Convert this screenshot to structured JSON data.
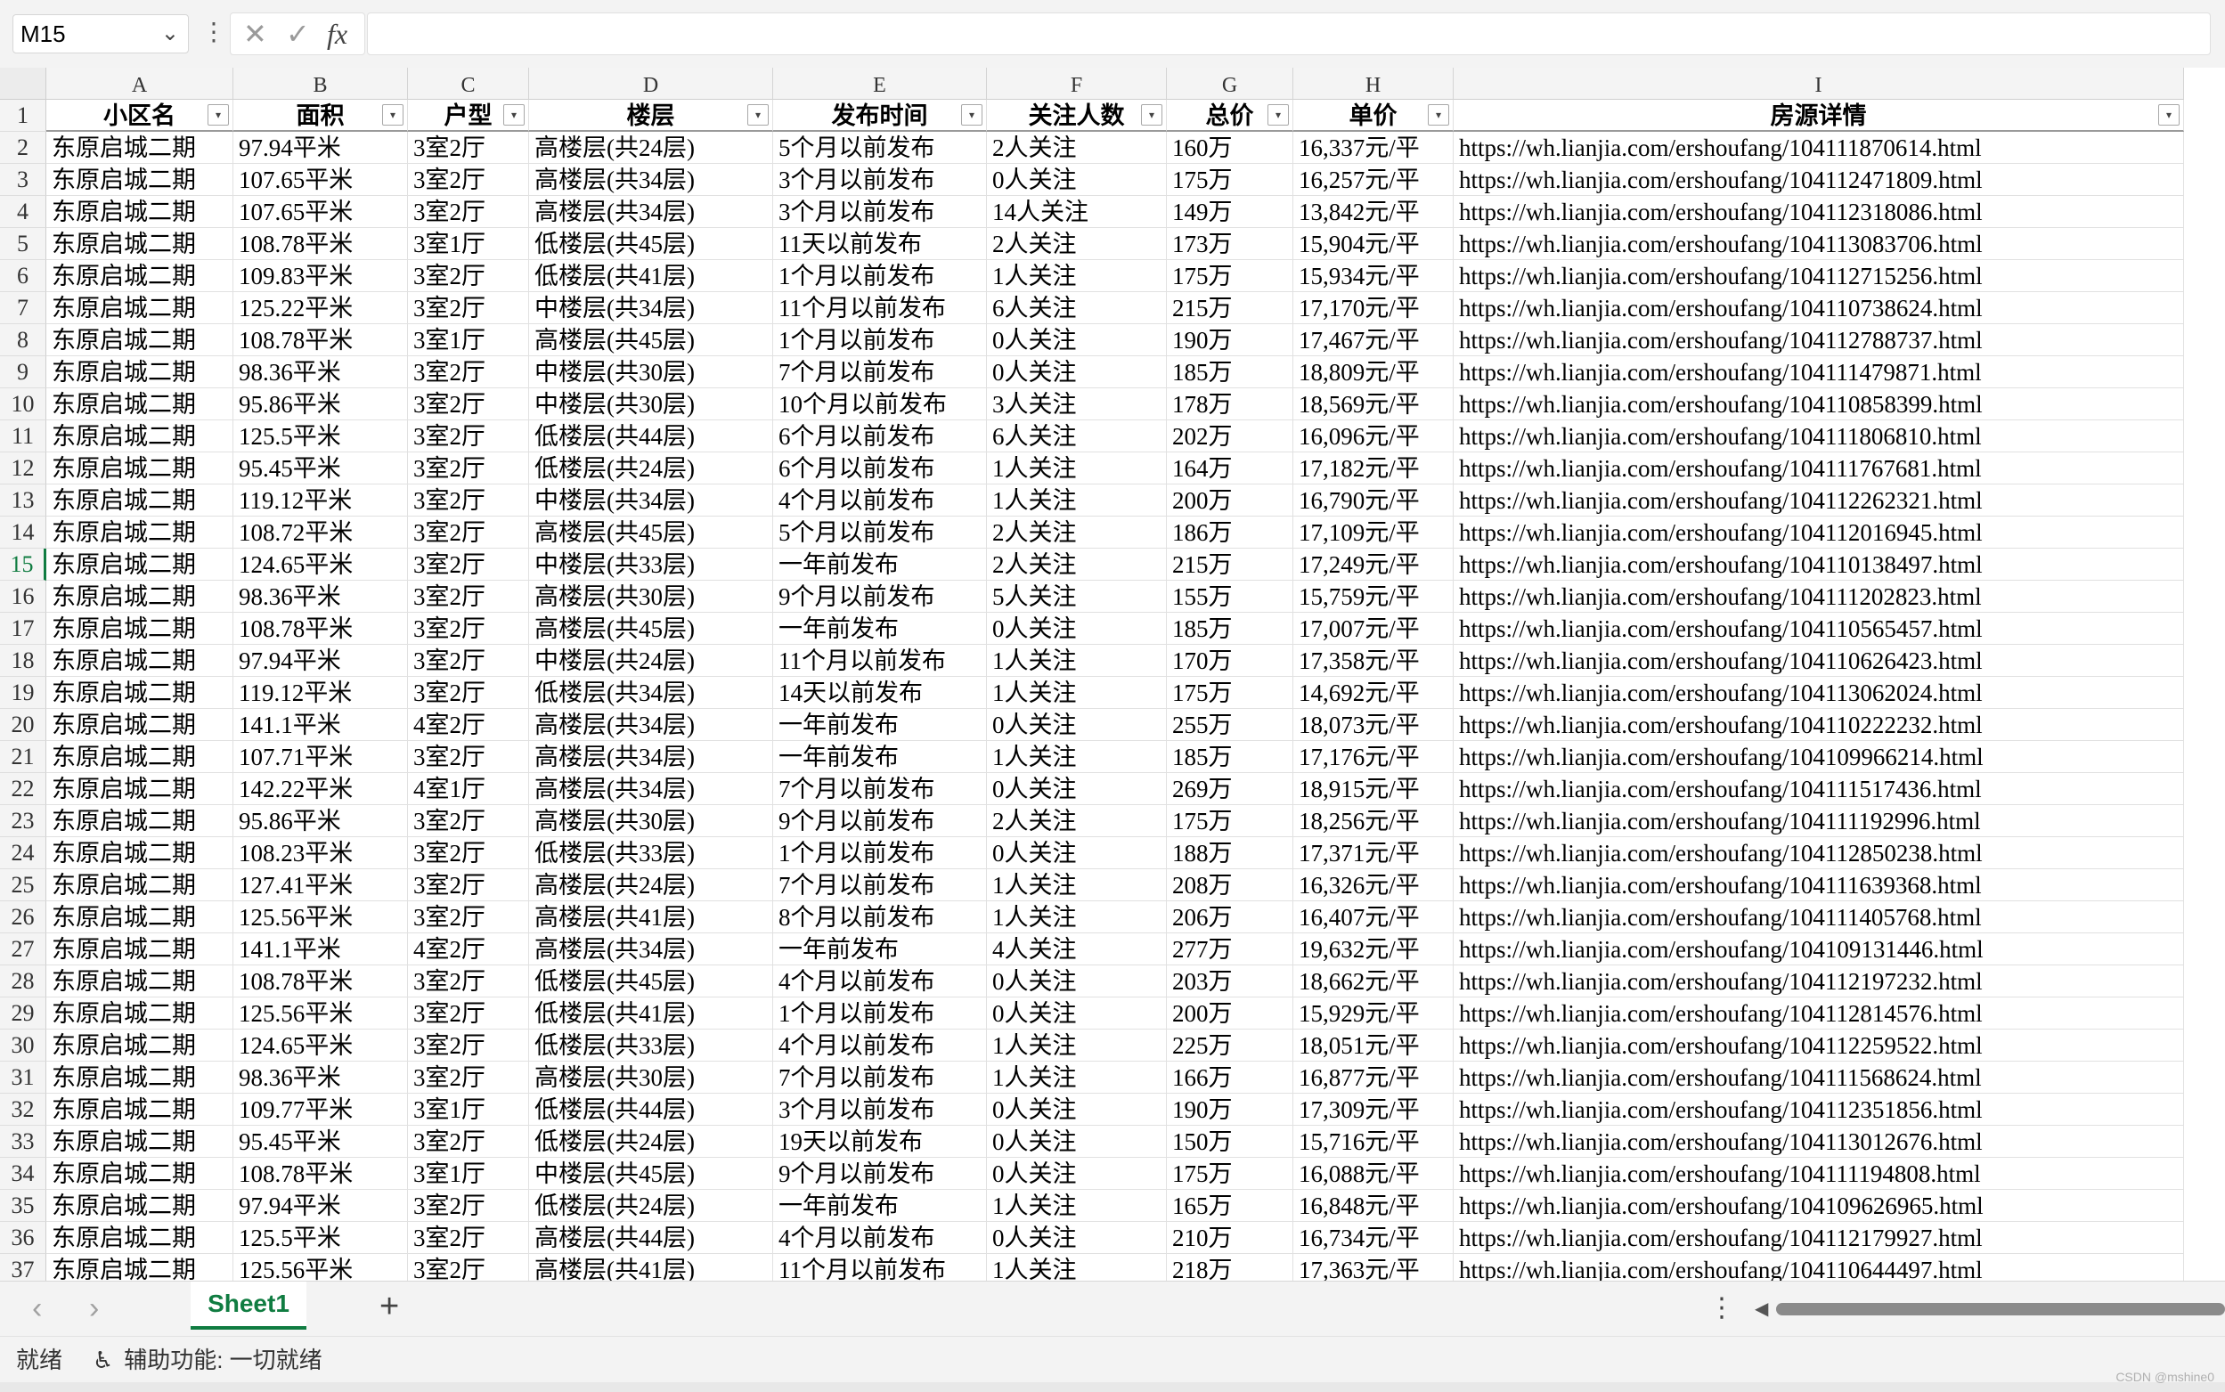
{
  "name_box": "M15",
  "formula_cancel": "✕",
  "formula_confirm": "✓",
  "formula_fx": "fx",
  "columns": [
    "A",
    "B",
    "C",
    "D",
    "E",
    "F",
    "G",
    "H",
    "I"
  ],
  "header": [
    "小区名",
    "面积",
    "户型",
    "楼层",
    "发布时间",
    "关注人数",
    "总价",
    "单价",
    "房源详情"
  ],
  "active_row": 15,
  "rows": [
    [
      "东原启城二期",
      "97.94平米",
      "3室2厅",
      "高楼层(共24层)",
      "5个月以前发布",
      "2人关注",
      "160万",
      "16,337元/平",
      "https://wh.lianjia.com/ershoufang/104111870614.html"
    ],
    [
      "东原启城二期",
      "107.65平米",
      "3室2厅",
      "高楼层(共34层)",
      "3个月以前发布",
      "0人关注",
      "175万",
      "16,257元/平",
      "https://wh.lianjia.com/ershoufang/104112471809.html"
    ],
    [
      "东原启城二期",
      "107.65平米",
      "3室2厅",
      "高楼层(共34层)",
      "3个月以前发布",
      "14人关注",
      "149万",
      "13,842元/平",
      "https://wh.lianjia.com/ershoufang/104112318086.html"
    ],
    [
      "东原启城二期",
      "108.78平米",
      "3室1厅",
      "低楼层(共45层)",
      "11天以前发布",
      "2人关注",
      "173万",
      "15,904元/平",
      "https://wh.lianjia.com/ershoufang/104113083706.html"
    ],
    [
      "东原启城二期",
      "109.83平米",
      "3室2厅",
      "低楼层(共41层)",
      "1个月以前发布",
      "1人关注",
      "175万",
      "15,934元/平",
      "https://wh.lianjia.com/ershoufang/104112715256.html"
    ],
    [
      "东原启城二期",
      "125.22平米",
      "3室2厅",
      "中楼层(共34层)",
      "11个月以前发布",
      "6人关注",
      "215万",
      "17,170元/平",
      "https://wh.lianjia.com/ershoufang/104110738624.html"
    ],
    [
      "东原启城二期",
      "108.78平米",
      "3室1厅",
      "高楼层(共45层)",
      "1个月以前发布",
      "0人关注",
      "190万",
      "17,467元/平",
      "https://wh.lianjia.com/ershoufang/104112788737.html"
    ],
    [
      "东原启城二期",
      "98.36平米",
      "3室2厅",
      "中楼层(共30层)",
      "7个月以前发布",
      "0人关注",
      "185万",
      "18,809元/平",
      "https://wh.lianjia.com/ershoufang/104111479871.html"
    ],
    [
      "东原启城二期",
      "95.86平米",
      "3室2厅",
      "中楼层(共30层)",
      "10个月以前发布",
      "3人关注",
      "178万",
      "18,569元/平",
      "https://wh.lianjia.com/ershoufang/104110858399.html"
    ],
    [
      "东原启城二期",
      "125.5平米",
      "3室2厅",
      "低楼层(共44层)",
      "6个月以前发布",
      "6人关注",
      "202万",
      "16,096元/平",
      "https://wh.lianjia.com/ershoufang/104111806810.html"
    ],
    [
      "东原启城二期",
      "95.45平米",
      "3室2厅",
      "低楼层(共24层)",
      "6个月以前发布",
      "1人关注",
      "164万",
      "17,182元/平",
      "https://wh.lianjia.com/ershoufang/104111767681.html"
    ],
    [
      "东原启城二期",
      "119.12平米",
      "3室2厅",
      "中楼层(共34层)",
      "4个月以前发布",
      "1人关注",
      "200万",
      "16,790元/平",
      "https://wh.lianjia.com/ershoufang/104112262321.html"
    ],
    [
      "东原启城二期",
      "108.72平米",
      "3室2厅",
      "高楼层(共45层)",
      "5个月以前发布",
      "2人关注",
      "186万",
      "17,109元/平",
      "https://wh.lianjia.com/ershoufang/104112016945.html"
    ],
    [
      "东原启城二期",
      "124.65平米",
      "3室2厅",
      "中楼层(共33层)",
      "一年前发布",
      "2人关注",
      "215万",
      "17,249元/平",
      "https://wh.lianjia.com/ershoufang/104110138497.html"
    ],
    [
      "东原启城二期",
      "98.36平米",
      "3室2厅",
      "高楼层(共30层)",
      "9个月以前发布",
      "5人关注",
      "155万",
      "15,759元/平",
      "https://wh.lianjia.com/ershoufang/104111202823.html"
    ],
    [
      "东原启城二期",
      "108.78平米",
      "3室2厅",
      "高楼层(共45层)",
      "一年前发布",
      "0人关注",
      "185万",
      "17,007元/平",
      "https://wh.lianjia.com/ershoufang/104110565457.html"
    ],
    [
      "东原启城二期",
      "97.94平米",
      "3室2厅",
      "中楼层(共24层)",
      "11个月以前发布",
      "1人关注",
      "170万",
      "17,358元/平",
      "https://wh.lianjia.com/ershoufang/104110626423.html"
    ],
    [
      "东原启城二期",
      "119.12平米",
      "3室2厅",
      "低楼层(共34层)",
      "14天以前发布",
      "1人关注",
      "175万",
      "14,692元/平",
      "https://wh.lianjia.com/ershoufang/104113062024.html"
    ],
    [
      "东原启城二期",
      "141.1平米",
      "4室2厅",
      "高楼层(共34层)",
      "一年前发布",
      "0人关注",
      "255万",
      "18,073元/平",
      "https://wh.lianjia.com/ershoufang/104110222232.html"
    ],
    [
      "东原启城二期",
      "107.71平米",
      "3室2厅",
      "高楼层(共34层)",
      "一年前发布",
      "1人关注",
      "185万",
      "17,176元/平",
      "https://wh.lianjia.com/ershoufang/104109966214.html"
    ],
    [
      "东原启城二期",
      "142.22平米",
      "4室1厅",
      "高楼层(共34层)",
      "7个月以前发布",
      "0人关注",
      "269万",
      "18,915元/平",
      "https://wh.lianjia.com/ershoufang/104111517436.html"
    ],
    [
      "东原启城二期",
      "95.86平米",
      "3室2厅",
      "高楼层(共30层)",
      "9个月以前发布",
      "2人关注",
      "175万",
      "18,256元/平",
      "https://wh.lianjia.com/ershoufang/104111192996.html"
    ],
    [
      "东原启城二期",
      "108.23平米",
      "3室2厅",
      "低楼层(共33层)",
      "1个月以前发布",
      "0人关注",
      "188万",
      "17,371元/平",
      "https://wh.lianjia.com/ershoufang/104112850238.html"
    ],
    [
      "东原启城二期",
      "127.41平米",
      "3室2厅",
      "高楼层(共24层)",
      "7个月以前发布",
      "1人关注",
      "208万",
      "16,326元/平",
      "https://wh.lianjia.com/ershoufang/104111639368.html"
    ],
    [
      "东原启城二期",
      "125.56平米",
      "3室2厅",
      "高楼层(共41层)",
      "8个月以前发布",
      "1人关注",
      "206万",
      "16,407元/平",
      "https://wh.lianjia.com/ershoufang/104111405768.html"
    ],
    [
      "东原启城二期",
      "141.1平米",
      "4室2厅",
      "高楼层(共34层)",
      "一年前发布",
      "4人关注",
      "277万",
      "19,632元/平",
      "https://wh.lianjia.com/ershoufang/104109131446.html"
    ],
    [
      "东原启城二期",
      "108.78平米",
      "3室2厅",
      "低楼层(共45层)",
      "4个月以前发布",
      "0人关注",
      "203万",
      "18,662元/平",
      "https://wh.lianjia.com/ershoufang/104112197232.html"
    ],
    [
      "东原启城二期",
      "125.56平米",
      "3室2厅",
      "低楼层(共41层)",
      "1个月以前发布",
      "0人关注",
      "200万",
      "15,929元/平",
      "https://wh.lianjia.com/ershoufang/104112814576.html"
    ],
    [
      "东原启城二期",
      "124.65平米",
      "3室2厅",
      "低楼层(共33层)",
      "4个月以前发布",
      "1人关注",
      "225万",
      "18,051元/平",
      "https://wh.lianjia.com/ershoufang/104112259522.html"
    ],
    [
      "东原启城二期",
      "98.36平米",
      "3室2厅",
      "高楼层(共30层)",
      "7个月以前发布",
      "1人关注",
      "166万",
      "16,877元/平",
      "https://wh.lianjia.com/ershoufang/104111568624.html"
    ],
    [
      "东原启城二期",
      "109.77平米",
      "3室1厅",
      "低楼层(共44层)",
      "3个月以前发布",
      "0人关注",
      "190万",
      "17,309元/平",
      "https://wh.lianjia.com/ershoufang/104112351856.html"
    ],
    [
      "东原启城二期",
      "95.45平米",
      "3室2厅",
      "低楼层(共24层)",
      "19天以前发布",
      "0人关注",
      "150万",
      "15,716元/平",
      "https://wh.lianjia.com/ershoufang/104113012676.html"
    ],
    [
      "东原启城二期",
      "108.78平米",
      "3室1厅",
      "中楼层(共45层)",
      "9个月以前发布",
      "0人关注",
      "175万",
      "16,088元/平",
      "https://wh.lianjia.com/ershoufang/104111194808.html"
    ],
    [
      "东原启城二期",
      "97.94平米",
      "3室2厅",
      "低楼层(共24层)",
      "一年前发布",
      "1人关注",
      "165万",
      "16,848元/平",
      "https://wh.lianjia.com/ershoufang/104109626965.html"
    ],
    [
      "东原启城二期",
      "125.5平米",
      "3室2厅",
      "高楼层(共44层)",
      "4个月以前发布",
      "0人关注",
      "210万",
      "16,734元/平",
      "https://wh.lianjia.com/ershoufang/104112179927.html"
    ],
    [
      "东原启城二期",
      "125.56平米",
      "3室2厅",
      "高楼层(共41层)",
      "11个月以前发布",
      "1人关注",
      "218万",
      "17,363元/平",
      "https://wh.lianjia.com/ershoufang/104110644497.html"
    ]
  ],
  "sheet_tabs": [
    "Sheet1"
  ],
  "add_sheet": "+",
  "status": {
    "ready": "就绪",
    "accessibility": "辅助功能: 一切就绪"
  },
  "watermark": "CSDN @mshine0",
  "icons": {
    "namebox_dropdown": "chevron-down-icon",
    "more_options": "vertical-dots-icon",
    "cancel": "close-icon",
    "confirm": "check-icon",
    "function": "fx-icon",
    "filter": "filter-dropdown-icon",
    "prev_sheet": "chevron-left-icon",
    "next_sheet": "chevron-right-icon",
    "accessibility": "accessibility-icon"
  }
}
